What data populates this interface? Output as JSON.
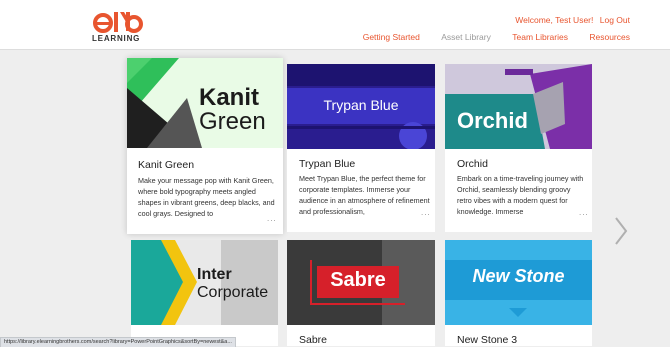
{
  "brand": {
    "logo_text": "LEARNING",
    "accent": "#e8552f"
  },
  "user": {
    "welcome": "Welcome, Test User!",
    "logout": "Log Out"
  },
  "nav": [
    {
      "label": "Getting Started",
      "active": true
    },
    {
      "label": "Asset Library",
      "active": false
    },
    {
      "label": "Team Libraries",
      "active": true
    },
    {
      "label": "Resources",
      "active": true
    }
  ],
  "cards": [
    {
      "title": "Kanit Green",
      "thumb_line1": "Kanit",
      "thumb_line2": "Green",
      "description": "Make your message pop with Kanit Green, where bold typography meets angled shapes in vibrant greens, deep blacks, and cool grays. Designed to",
      "more": "..."
    },
    {
      "title": "Trypan Blue",
      "thumb_line1": "Trypan Blue",
      "description": "Meet Trypan Blue, the perfect theme for corporate templates. Immerse your audience in an atmosphere of refinement and professionalism,",
      "more": "..."
    },
    {
      "title": "Orchid",
      "thumb_line1": "Orchid",
      "description": "Embark on a time-traveling journey with Orchid, seamlessly blending groovy retro vibes with a modern quest for knowledge. Immerse",
      "more": "..."
    },
    {
      "title": "",
      "thumb_line1": "Inter",
      "thumb_line2": "Corporate"
    },
    {
      "title": "Sabre",
      "thumb_line1": "Sabre"
    },
    {
      "title": "New Stone 3",
      "thumb_line1": "New Stone"
    }
  ],
  "status_bar": {
    "url": "https://library.elearningbrothers.com/search?library=PowerPointGraphics&sortBy=newest&a..."
  }
}
